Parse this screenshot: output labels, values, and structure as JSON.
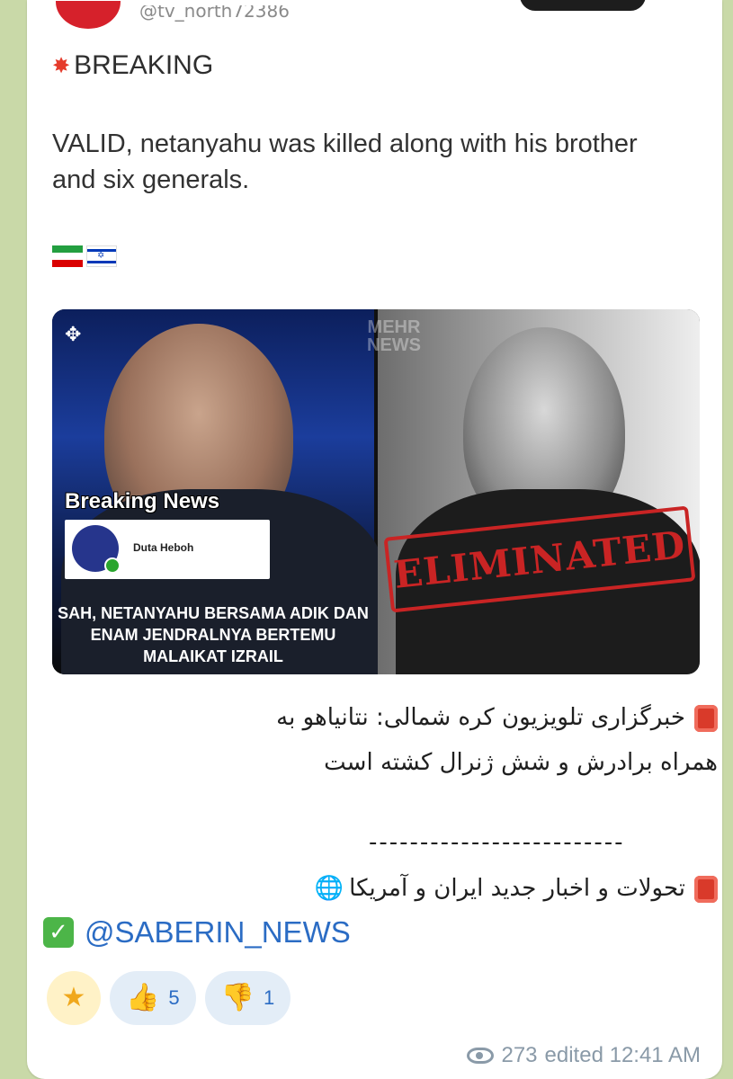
{
  "tweet": {
    "handle": "@tv_north72386",
    "breaking_label": "BREAKING",
    "body": "VALID, netanyahu was killed along with his brother and six generals."
  },
  "image": {
    "watermark": "MEHR NEWS",
    "breaking_title": "Breaking News",
    "source_name": "Duta Heboh",
    "caption": "SAH, NETANYAHU BERSAMA ADIK DAN ENAM JENDRALNYA BERTEMU MALAIKAT IZRAIL",
    "stamp": "ELIMINATED"
  },
  "message": {
    "fa_line1": "خبرگزاری تلویزیون کره شمالی: نتانیاهو به",
    "fa_line2": "همراه برادرش و  شش ژنرال کشته است",
    "separator": "-------------------------",
    "fa_line3": "تحولات و اخبار جدید ایران و آمریکا",
    "channel_handle": "@SABERIN_NEWS"
  },
  "reactions": [
    {
      "icon": "star-icon",
      "glyph": "★",
      "count": ""
    },
    {
      "icon": "thumbs-up-icon",
      "glyph": "👍",
      "count": "5"
    },
    {
      "icon": "thumbs-down-icon",
      "glyph": "👎",
      "count": "1"
    }
  ],
  "meta": {
    "views": "273",
    "edited": "edited 12:41 AM"
  },
  "colors": {
    "link": "#2b6cc4",
    "stamp_red": "#c92424",
    "chat_bg": "#c9d9a8"
  }
}
